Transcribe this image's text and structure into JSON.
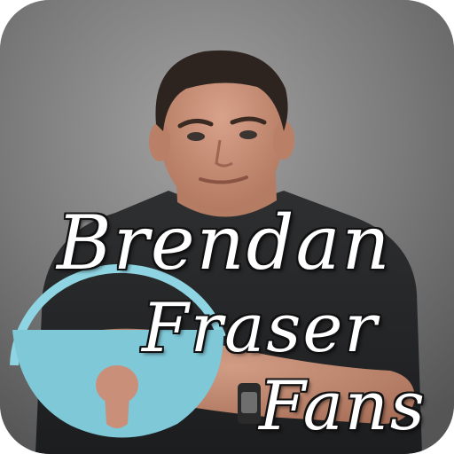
{
  "app_icon": {
    "title_lines": [
      "Brendan",
      "Fraser",
      "Fans"
    ],
    "icon_name": "brendan-fraser-fans-app-icon",
    "colors": {
      "background_gray": "#7c7c7c",
      "shirt": "#262729",
      "skin": "#c99077",
      "hair": "#2d241f",
      "title_text": "#ffffff",
      "title_outline": "#111111",
      "badge_cyan": "#7fc8d8",
      "badge_ring": "#8fd4e2"
    },
    "badge_icon": "padlock-icon"
  }
}
